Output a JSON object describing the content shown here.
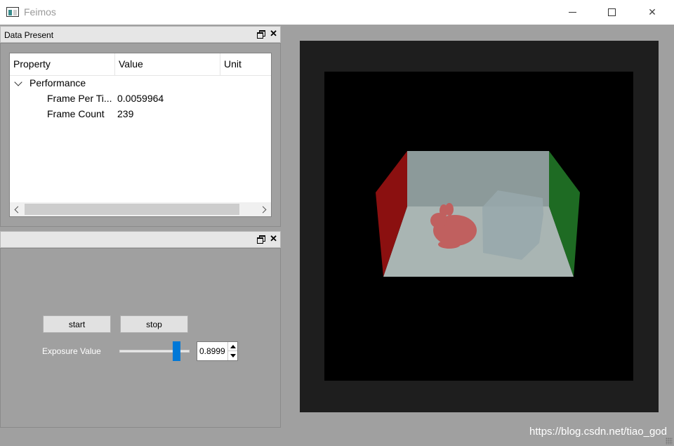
{
  "window": {
    "title": "Feimos",
    "minimize_icon": "minimize-icon",
    "maximize_icon": "maximize-icon",
    "close_icon": "close-icon"
  },
  "data_present": {
    "title": "Data Present",
    "columns": [
      "Property",
      "Value",
      "Unit"
    ],
    "group": "Performance",
    "rows": [
      {
        "property": "Frame Per Ti...",
        "value": "0.0059964",
        "unit": ""
      },
      {
        "property": "Frame Count",
        "value": "239",
        "unit": ""
      }
    ]
  },
  "control_panel": {
    "title": "",
    "start_label": "start",
    "stop_label": "stop",
    "exposure_label": "Exposure Value",
    "exposure_value": "0.8999",
    "slider_fraction": 0.85
  },
  "colors": {
    "left_wall": "#8b1010",
    "right_wall": "#1e6b23",
    "back_wall": "#8c9a9a",
    "floor": "#a9b5b3",
    "bunny": "#c0605f",
    "box": "#98a8ab",
    "slider_handle": "#0078d7"
  },
  "watermark": "https://blog.csdn.net/tiao_god"
}
